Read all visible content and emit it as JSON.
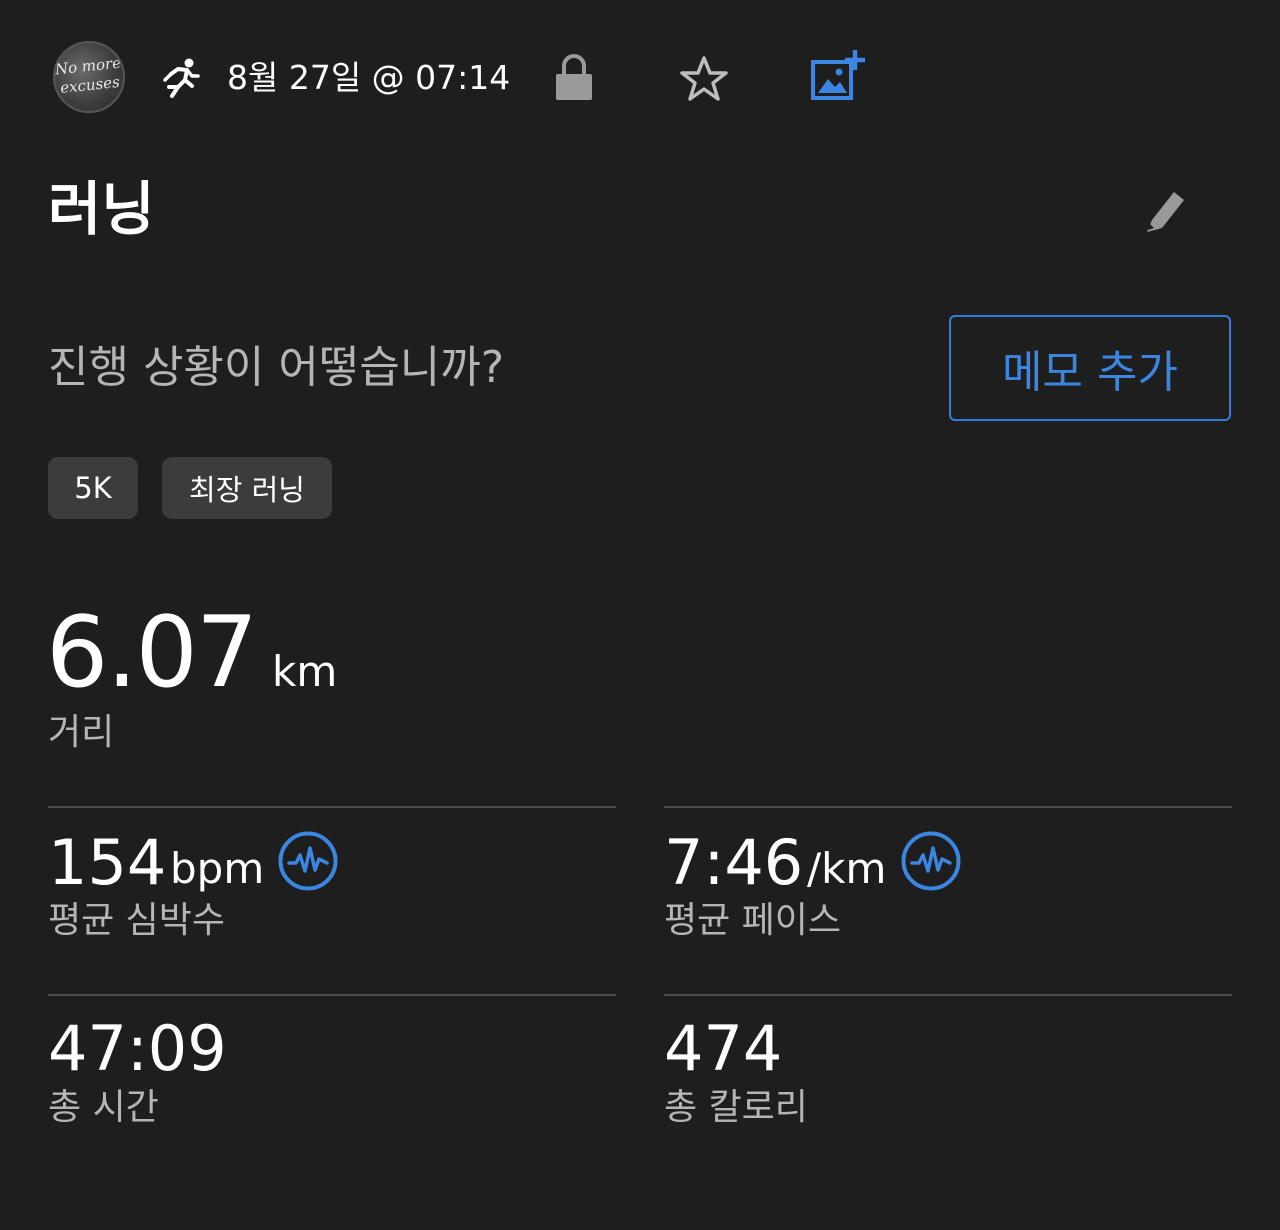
{
  "header": {
    "avatar_text_line1": "No more",
    "avatar_text_line2": "excuses",
    "activity_icon": "running-person-icon",
    "date_time": "8월 27일 @ 07:14",
    "icons": [
      "lock-icon",
      "star-icon",
      "add-photo-icon"
    ],
    "accent_color": "#3a86e0"
  },
  "title": "러닝",
  "prompt": "진행 상황이 어떻습니까?",
  "memo_button_label": "메모 추가",
  "chips": [
    "5K",
    "최장 러닝"
  ],
  "distance": {
    "value": "6.07",
    "unit": "km",
    "label": "거리"
  },
  "stats": {
    "heart_rate": {
      "value": "154",
      "unit": "bpm",
      "label": "평균 심박수"
    },
    "pace": {
      "value": "7:46",
      "unit": "/km",
      "label": "평균 페이스"
    },
    "time": {
      "value": "47:09",
      "label": "총 시간"
    },
    "calories": {
      "value": "474",
      "label": "총 칼로리"
    }
  }
}
